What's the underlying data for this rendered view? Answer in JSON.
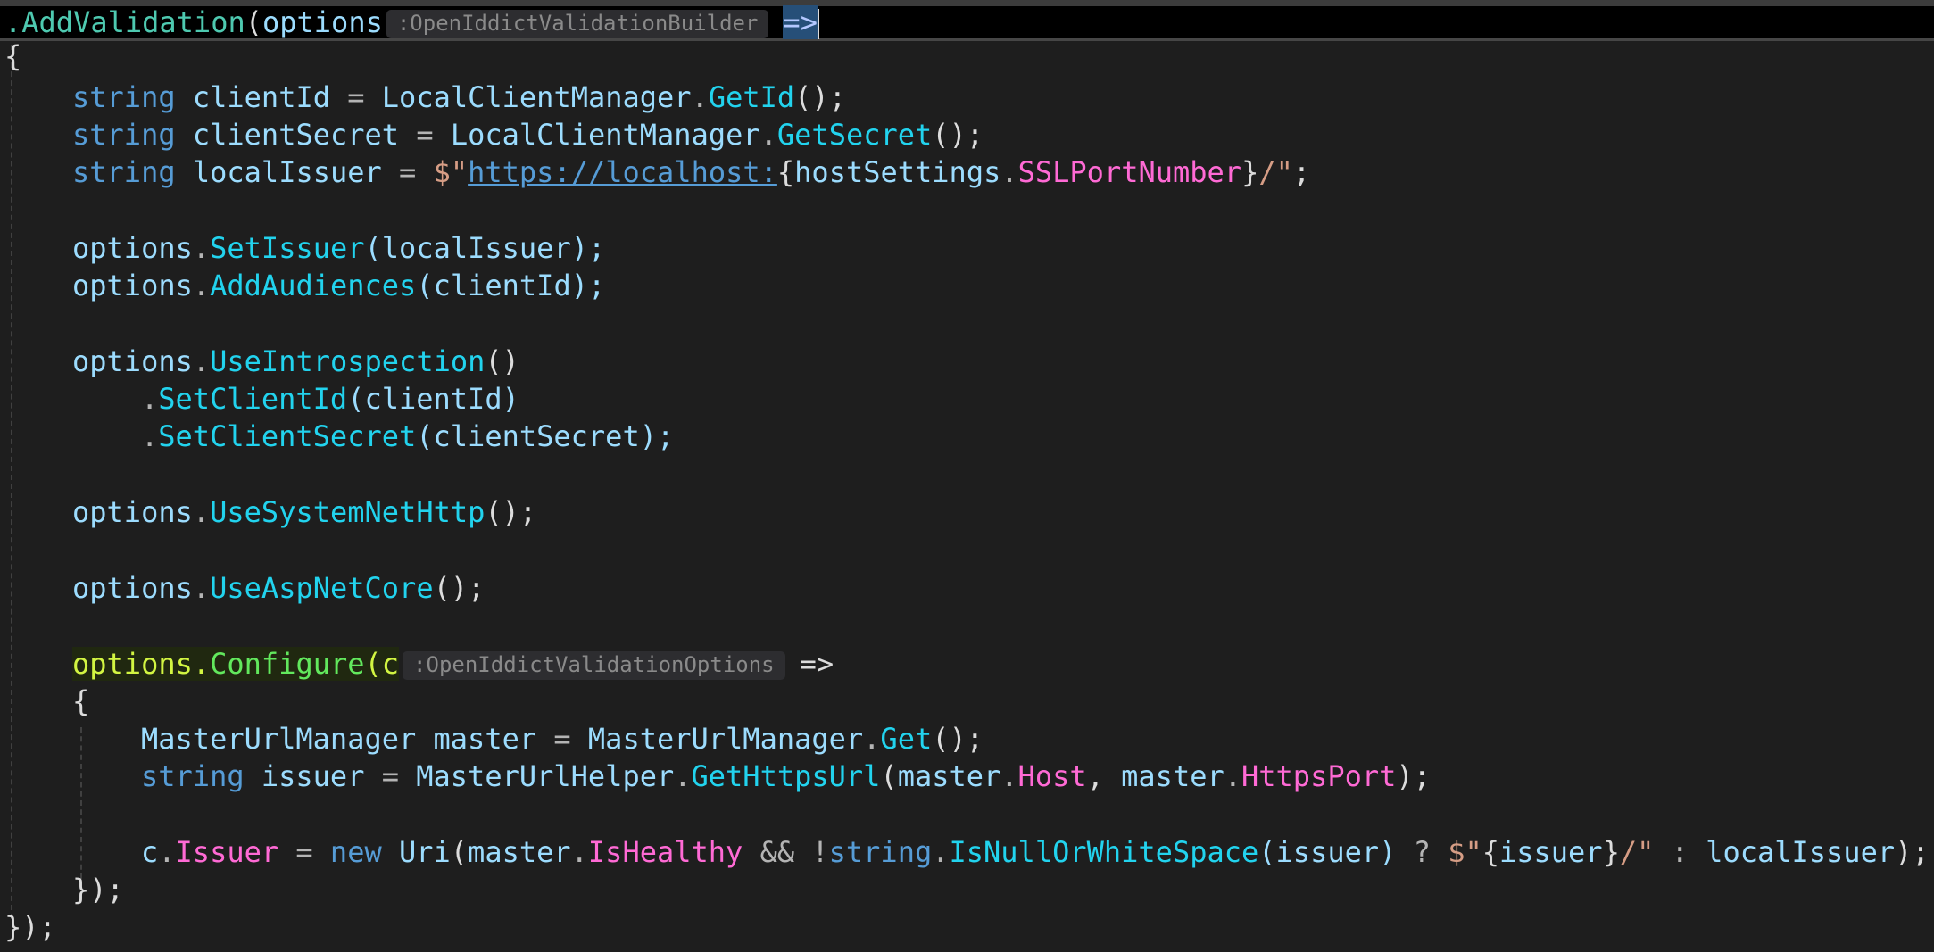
{
  "editor": {
    "line1": {
      "dot": ".",
      "method": "AddValidation",
      "open_paren": "(",
      "param": "options",
      "hint": ":OpenIddictValidationBuilder",
      "arrow": "=>"
    },
    "line2": {
      "text": "{"
    },
    "line3": {
      "kw": "string",
      "var": " clientId",
      "eq": " = ",
      "cls": "LocalClientManager",
      "dot": ".",
      "method": "GetId",
      "end": "();"
    },
    "line4": {
      "kw": "string",
      "var": " clientSecret",
      "eq": " = ",
      "cls": "LocalClientManager",
      "dot": ".",
      "method": "GetSecret",
      "end": "();"
    },
    "line5": {
      "kw": "string",
      "var": " localIssuer",
      "eq": " = ",
      "dollar": "$\"",
      "url": "https://localhost:",
      "brace_open": "{",
      "obj": "hostSettings",
      "dot": ".",
      "prop": "SSLPortNumber",
      "brace_close": "}",
      "str_end": "/\"",
      "semi": ";"
    },
    "line7": {
      "obj": "options",
      "dot": ".",
      "method": "SetIssuer",
      "args": "(localIssuer);"
    },
    "line8": {
      "obj": "options",
      "dot": ".",
      "method": "AddAudiences",
      "args": "(clientId);"
    },
    "line10": {
      "obj": "options",
      "dot": ".",
      "method": "UseIntrospection",
      "args": "()"
    },
    "line11": {
      "dot": ".",
      "method": "SetClientId",
      "args": "(clientId)"
    },
    "line12": {
      "dot": ".",
      "method": "SetClientSecret",
      "args": "(clientSecret);"
    },
    "line14": {
      "obj": "options",
      "dot": ".",
      "method": "UseSystemNetHttp",
      "args": "();"
    },
    "line16": {
      "obj": "options",
      "dot": ".",
      "method": "UseAspNetCore",
      "args": "();"
    },
    "line18": {
      "obj": "options",
      "dot": ".",
      "method": "Configure",
      "paren": "(",
      "param": "c",
      "hint": ":OpenIddictValidationOptions",
      "arrow": "=>"
    },
    "line19": {
      "text": "{"
    },
    "line20": {
      "cls": "MasterUrlManager",
      "var": " master",
      "eq": " = ",
      "cls2": "MasterUrlManager",
      "dot": ".",
      "method": "Get",
      "end": "();"
    },
    "line21": {
      "kw": "string",
      "var": " issuer",
      "eq": " = ",
      "cls": "MasterUrlHelper",
      "dot": ".",
      "method": "GetHttpsUrl",
      "p1": "(",
      "obj1": "master",
      "dot1": ".",
      "prop1": "Host",
      "comma": ", ",
      "obj2": "master",
      "dot2": ".",
      "prop2": "HttpsPort",
      "end": ");"
    },
    "line23": {
      "obj": "c",
      "dot": ".",
      "prop": "Issuer",
      "eq": " = ",
      "kw_new": "new",
      "cls": " Uri",
      "p1": "(",
      "obj1": "master",
      "dot1": ".",
      "prop1": "IsHealthy",
      "and": " && ",
      "not": "!",
      "kw_string": "string",
      "dot2": ".",
      "method": "IsNullOrWhiteSpace",
      "arg": "(issuer)",
      "q": " ? ",
      "dollar": "$\"",
      "brace_open": "{",
      "interp": "issuer",
      "brace_close": "}",
      "str_end": "/\"",
      "colon": " : ",
      "local": "localIssuer",
      "end": ");"
    },
    "line24": {
      "text": "});"
    },
    "line25": {
      "text": "});"
    }
  }
}
